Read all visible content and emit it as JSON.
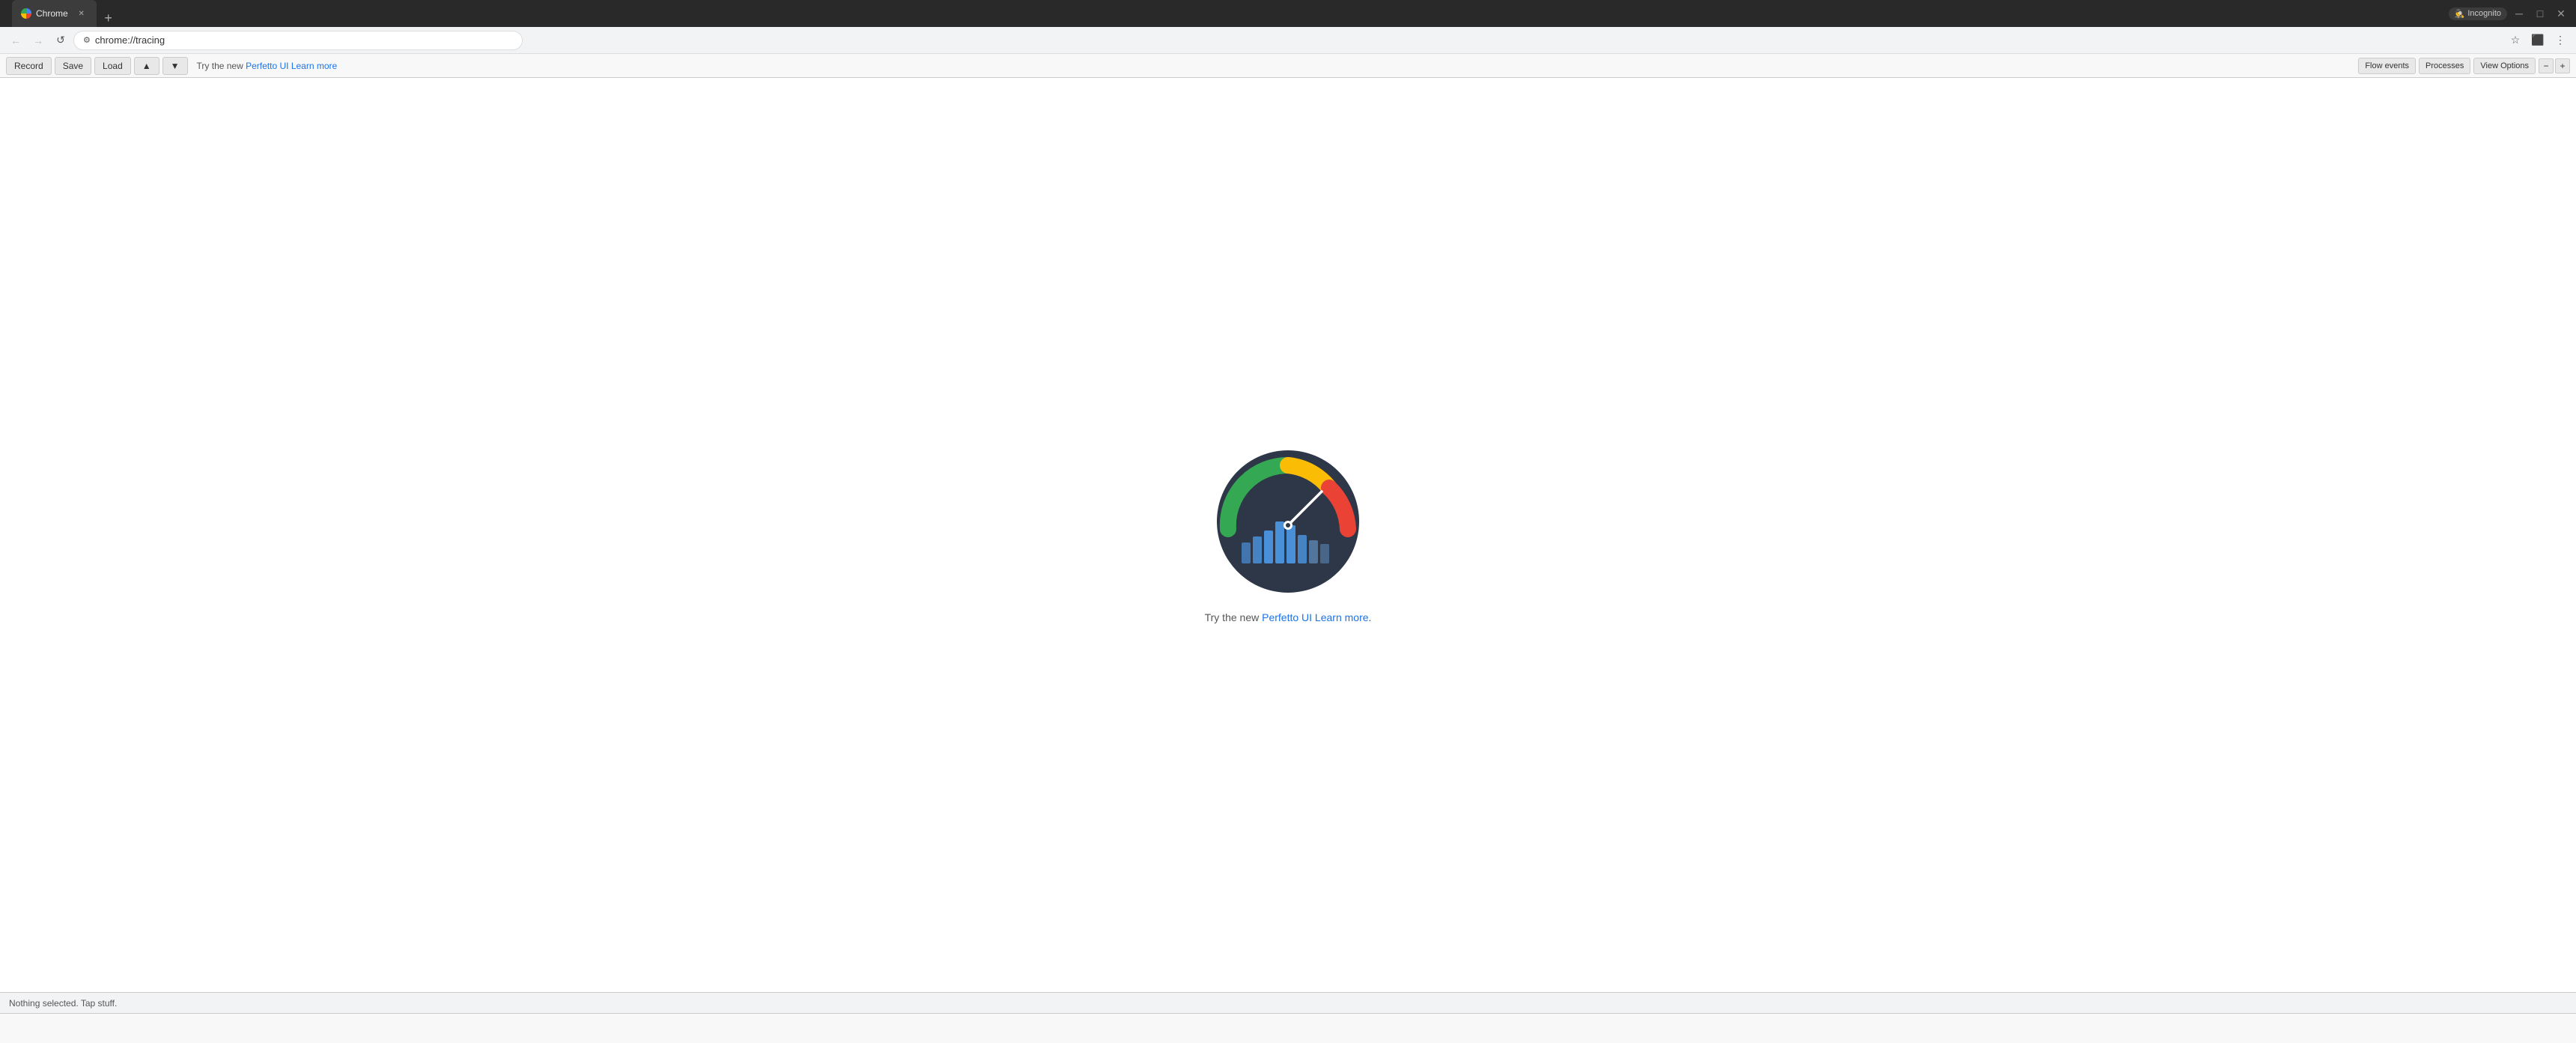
{
  "browser": {
    "tab": {
      "title": "Chrome",
      "url": "chrome://tracing",
      "favicon": "chrome-icon"
    },
    "address": {
      "lock_icon": "🔒",
      "url_text": "chrome://tracing"
    },
    "incognito_label": "Incognito"
  },
  "toolbar": {
    "record_label": "Record",
    "save_label": "Save",
    "load_label": "Load",
    "up_label": "▲",
    "down_label": "▼",
    "notice_prefix": "Try the new ",
    "perfetto_link_text": "Perfetto UI",
    "learn_more_text": "Learn more",
    "flow_events_label": "Flow events",
    "processes_label": "Processes",
    "view_options_label": "View Options",
    "zoom_out_label": "−",
    "zoom_in_label": "+"
  },
  "main": {
    "logo_alt": "Chrome Tracing logo - speedometer",
    "notice_prefix": "Try the new ",
    "perfetto_link_text": "Perfetto UI",
    "learn_more_text": "Learn more",
    "notice_suffix": "."
  },
  "status_bar": {
    "message": "Nothing selected. Tap stuff."
  },
  "nav": {
    "back_icon": "←",
    "forward_icon": "→",
    "reload_icon": "↺",
    "star_icon": "☆",
    "extensions_icon": "⬛",
    "menu_icon": "⋮"
  }
}
